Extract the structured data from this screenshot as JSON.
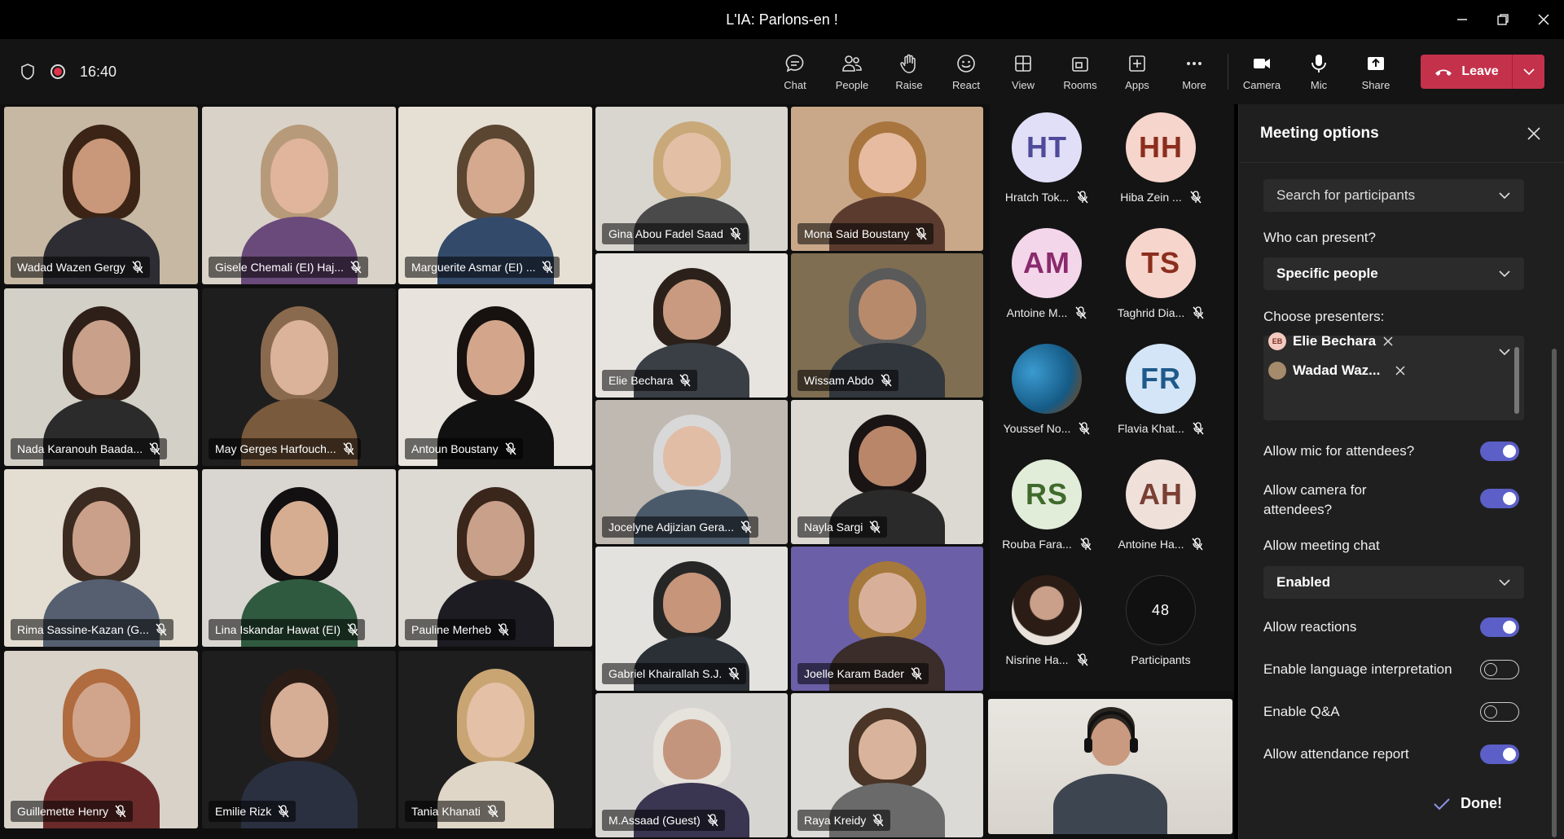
{
  "window": {
    "title": "L'IA: Parlons-en !"
  },
  "toolbar": {
    "time": "16:40",
    "buttons": [
      {
        "label": "Chat"
      },
      {
        "label": "People"
      },
      {
        "label": "Raise"
      },
      {
        "label": "React"
      },
      {
        "label": "View"
      },
      {
        "label": "Rooms"
      },
      {
        "label": "Apps"
      },
      {
        "label": "More"
      },
      {
        "label": "Camera"
      },
      {
        "label": "Mic"
      },
      {
        "label": "Share"
      }
    ],
    "leave_label": "Leave"
  },
  "tiles": [
    {
      "name": "Wadad Wazen Gergy"
    },
    {
      "name": "Gisele Chemali (EI) Haj..."
    },
    {
      "name": "Marguerite Asmar (EI) ..."
    },
    {
      "name": "Gina Abou Fadel Saad"
    },
    {
      "name": "Mona Said Boustany"
    },
    {
      "name": "Nada Karanouh Baada..."
    },
    {
      "name": "May Gerges Harfouch..."
    },
    {
      "name": "Antoun Boustany"
    },
    {
      "name": "Elie Bechara"
    },
    {
      "name": "Wissam Abdo"
    },
    {
      "name": "Rima Sassine-Kazan (G..."
    },
    {
      "name": "Lina Iskandar Hawat (EI)"
    },
    {
      "name": "Pauline Merheb"
    },
    {
      "name": "Jocelyne Adjizian Gera..."
    },
    {
      "name": "Nayla Sargi"
    },
    {
      "name": "Guillemette Henry"
    },
    {
      "name": "Emilie Rizk"
    },
    {
      "name": "Tania Khanati"
    },
    {
      "name": "Gabriel Khairallah S.J."
    },
    {
      "name": "Joelle Karam Bader"
    },
    {
      "name": "M.Assaad (Guest)"
    },
    {
      "name": "Raya Kreidy"
    }
  ],
  "roster": [
    {
      "initials": "HT",
      "name": "Hratch Tok...",
      "bg": "#e1dff7",
      "fg": "#4f4a9a"
    },
    {
      "initials": "HH",
      "name": "Hiba Zein ...",
      "bg": "#f6d5cc",
      "fg": "#8b2e1e"
    },
    {
      "initials": "AM",
      "name": "Antoine M...",
      "bg": "#f4d6ea",
      "fg": "#8a2a6c"
    },
    {
      "initials": "TS",
      "name": "Taghrid Dia...",
      "bg": "#f6d5cc",
      "fg": "#8b2e1e"
    },
    {
      "initials": "",
      "name": "Youssef No...",
      "bg": "#1d6c98",
      "fg": "#fff"
    },
    {
      "initials": "FR",
      "name": "Flavia Khat...",
      "bg": "#d3e5f7",
      "fg": "#1f5a8a"
    },
    {
      "initials": "RS",
      "name": "Rouba Fara...",
      "bg": "#e2edd9",
      "fg": "#3f6a2c"
    },
    {
      "initials": "AH",
      "name": "Antoine Ha...",
      "bg": "#efe0da",
      "fg": "#7a3f33"
    },
    {
      "initials": "",
      "name": "Nisrine Ha...",
      "bg": "#d8c7b3",
      "fg": "#fff"
    },
    {
      "initials": "48",
      "name": "Participants",
      "bg": "#111111",
      "fg": "#fff"
    }
  ],
  "panel": {
    "title": "Meeting options",
    "search_placeholder": "Search for participants",
    "who_can_present_label": "Who can present?",
    "who_can_present_value": "Specific people",
    "choose_presenters_label": "Choose presenters:",
    "presenters": [
      {
        "badge": "EB",
        "name": "Elie Bechara"
      },
      {
        "badge": "",
        "name": "Wadad Waz..."
      }
    ],
    "allow_mic_label": "Allow mic for attendees?",
    "allow_mic": true,
    "allow_camera_label": "Allow camera for attendees?",
    "allow_camera": true,
    "meeting_chat_label": "Allow meeting chat",
    "meeting_chat_value": "Enabled",
    "allow_reactions_label": "Allow reactions",
    "allow_reactions": true,
    "language_interp_label": "Enable language interpretation",
    "language_interp": false,
    "qa_label": "Enable Q&A",
    "qa": false,
    "attendance_label": "Allow attendance report",
    "attendance": true,
    "done_label": "Done!"
  },
  "colors": {
    "accent": "#5b5fc7",
    "leave": "#c4314b"
  }
}
